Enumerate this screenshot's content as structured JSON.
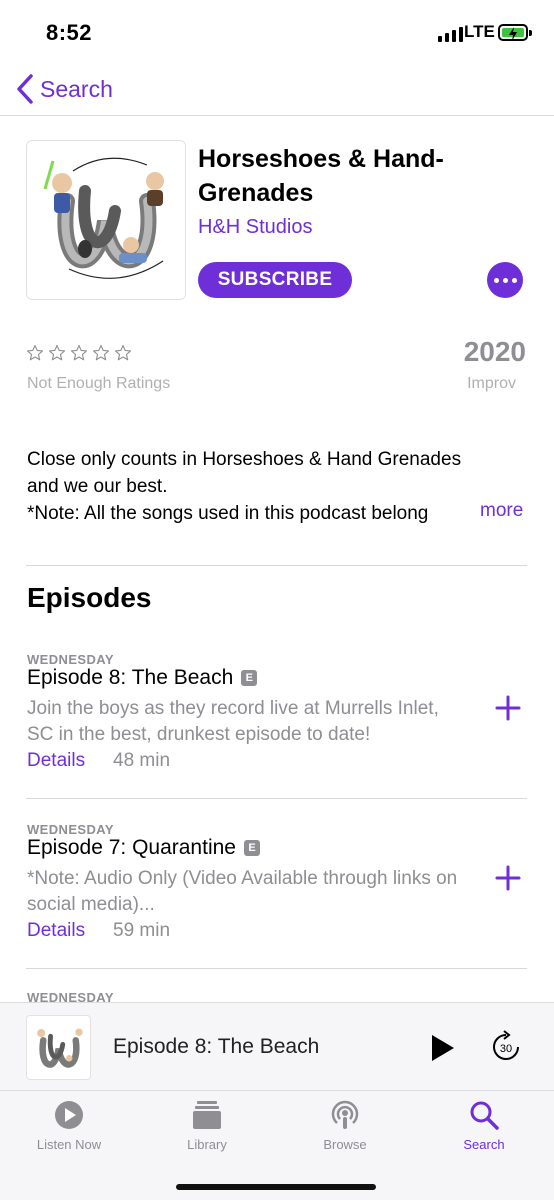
{
  "status_bar": {
    "time": "8:52",
    "network": "LTE"
  },
  "nav": {
    "back_label": "Search"
  },
  "podcast": {
    "title": "Horseshoes & Hand-Grenades",
    "author": "H&H Studios",
    "subscribe_label": "SUBSCRIBE",
    "ratings_label": "Not Enough Ratings",
    "stars_filled": 0,
    "stars_total": 5,
    "year": "2020",
    "genre": "Improv",
    "description_lines": [
      "Close only counts in Horseshoes & Hand Grenades",
      "and we our best.",
      "*Note: All the songs used in this podcast belong"
    ],
    "more_label": "more"
  },
  "episodes_heading": "Episodes",
  "episodes": [
    {
      "day": "WEDNESDAY",
      "title": "Episode 8: The Beach",
      "explicit": "E",
      "description": "Join the boys as they record live at Murrells Inlet, SC in the best, drunkest episode to date!",
      "details_label": "Details",
      "duration": "48 min"
    },
    {
      "day": "WEDNESDAY",
      "title": "Episode 7: Quarantine",
      "explicit": "E",
      "description": "*Note: Audio Only (Video Available through links on social media)...",
      "details_label": "Details",
      "duration": "59 min"
    }
  ],
  "peek_day": "WEDNESDAY",
  "mini_player": {
    "title": "Episode 8: The Beach",
    "skip_seconds": "30"
  },
  "tabs": [
    {
      "label": "Listen Now",
      "icon": "play-circle-icon",
      "active": false
    },
    {
      "label": "Library",
      "icon": "library-stack-icon",
      "active": false
    },
    {
      "label": "Browse",
      "icon": "podcasts-icon",
      "active": false
    },
    {
      "label": "Search",
      "icon": "search-icon",
      "active": true
    }
  ],
  "colors": {
    "accent": "#6f2fd8",
    "secondary_text": "#8e8e93",
    "battery": "#3fc33f"
  }
}
